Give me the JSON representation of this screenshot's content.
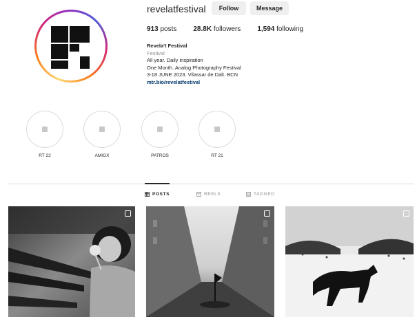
{
  "profile": {
    "username": "revelatfestival",
    "follow_label": "Follow",
    "message_label": "Message",
    "stats": {
      "posts_count": "913",
      "posts_label": "posts",
      "followers_count": "28.8K",
      "followers_label": "followers",
      "following_count": "1,594",
      "following_label": "following"
    },
    "bio": {
      "name": "Revela't Festival",
      "category": "Festival",
      "lines": [
        "All year. Daily inspiration",
        "One Month. Analog Photography Festival",
        "3-18 JUNE 2023. Vilassar de Dalt. BCN"
      ],
      "link": "mtr.bio/revelatfestival"
    }
  },
  "highlights": [
    {
      "label": "RT 22"
    },
    {
      "label": "AMIGX"
    },
    {
      "label": "PATROS"
    },
    {
      "label": "RT 21"
    }
  ],
  "tabs": [
    {
      "label": "POSTS",
      "icon": "grid-icon",
      "active": true
    },
    {
      "label": "REELS",
      "icon": "reels-icon",
      "active": false
    },
    {
      "label": "TAGGED",
      "icon": "tagged-icon",
      "active": false
    }
  ],
  "posts": [
    {
      "description": "Black and white photo of a girl holding a flower before rifles",
      "icon": "multi-post-icon"
    },
    {
      "description": "Black and white photo of a figure with a flag on a street",
      "icon": "multi-post-icon"
    },
    {
      "description": "Black and white photo of a dog in snow",
      "icon": "multi-post-icon"
    }
  ],
  "colors": {
    "button_bg": "#efefef",
    "link": "#00376b",
    "muted": "#8e8e8e",
    "border": "#dbdbdb"
  }
}
